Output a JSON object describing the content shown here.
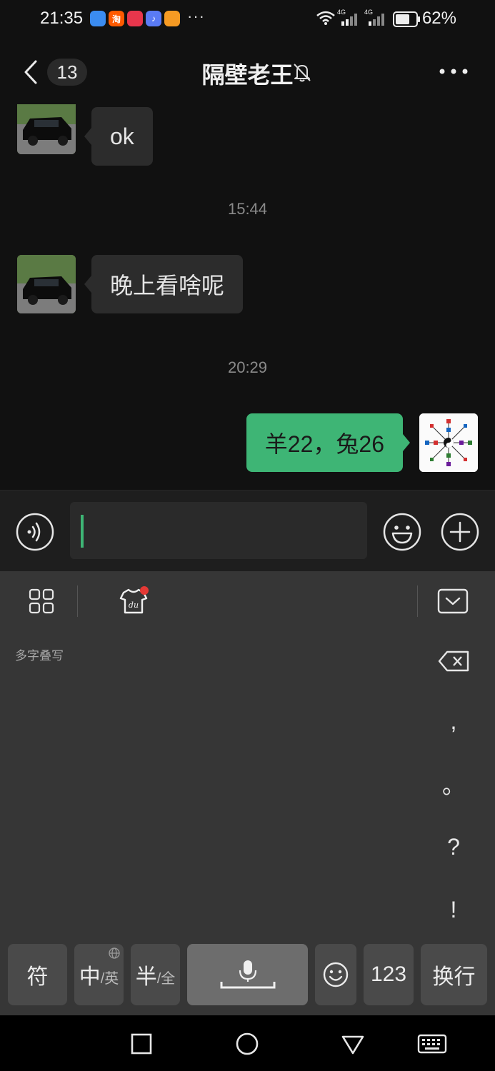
{
  "status_bar": {
    "time": "21:35",
    "app_icons": [
      "browser-icon",
      "taobao-icon",
      "reader-icon",
      "music-icon",
      "shop-icon"
    ],
    "app_icon_labels": [
      "",
      "淘",
      "",
      "♪",
      ""
    ],
    "more_indicator": "···",
    "network_1": "4G",
    "network_2": "4G",
    "battery": "62%"
  },
  "header": {
    "unread_count": "13",
    "title": "隔壁老王"
  },
  "messages": [
    {
      "type": "received",
      "text": "ok"
    },
    {
      "type": "timestamp",
      "text": "15:44"
    },
    {
      "type": "received",
      "text": "晚上看啥呢"
    },
    {
      "type": "timestamp",
      "text": "20:29"
    },
    {
      "type": "sent",
      "text": "羊22，兔26"
    }
  ],
  "input": {
    "value": ""
  },
  "keyboard": {
    "handwrite_hint": "多字叠写",
    "side_keys": [
      ",",
      "。",
      "?",
      "!"
    ],
    "keys": {
      "symbol": "符",
      "lang_main": "中",
      "lang_sub": "/英",
      "width_main": "半",
      "width_sub": "/全",
      "numbers": "123",
      "enter": "换行"
    }
  },
  "colors": {
    "sent_bubble": "#3eb575",
    "received_bubble": "#2c2c2c",
    "background": "#111111",
    "keyboard": "#363636",
    "caret": "#3eb575",
    "notification_dot": "#e53935"
  }
}
